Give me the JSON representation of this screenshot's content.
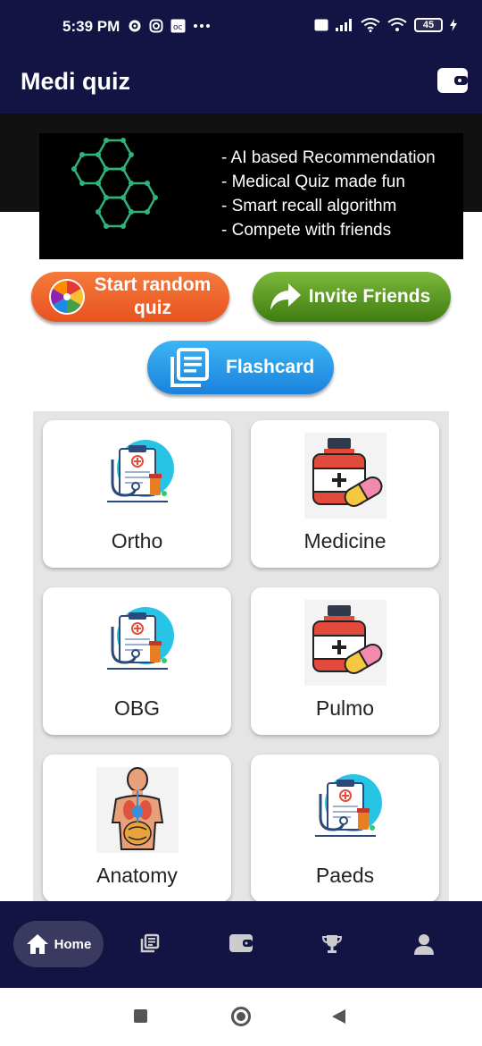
{
  "status": {
    "time": "5:39 PM",
    "battery": "45"
  },
  "app": {
    "title": "Medi quiz"
  },
  "banner": {
    "lines": [
      "- AI based Recommendation",
      "- Medical Quiz made fun",
      "- Smart recall algorithm",
      "- Compete with friends"
    ]
  },
  "actions": {
    "random_line1": "Start random",
    "random_line2": "quiz",
    "invite": "Invite Friends",
    "flashcard": "Flashcard"
  },
  "categories": [
    {
      "label": "Ortho",
      "icon": "clipboard-stethoscope-icon"
    },
    {
      "label": "Medicine",
      "icon": "medicine-bottle-icon"
    },
    {
      "label": "OBG",
      "icon": "clipboard-stethoscope-icon"
    },
    {
      "label": "Pulmo",
      "icon": "medicine-bottle-icon"
    },
    {
      "label": "Anatomy",
      "icon": "anatomy-body-icon"
    },
    {
      "label": "Paeds",
      "icon": "clipboard-stethoscope-icon"
    }
  ],
  "nav": {
    "home": "Home"
  },
  "colors": {
    "primary": "#131443",
    "random": "#ef6a2c",
    "invite": "#5a9a25",
    "flashcard": "#2b9be8"
  }
}
